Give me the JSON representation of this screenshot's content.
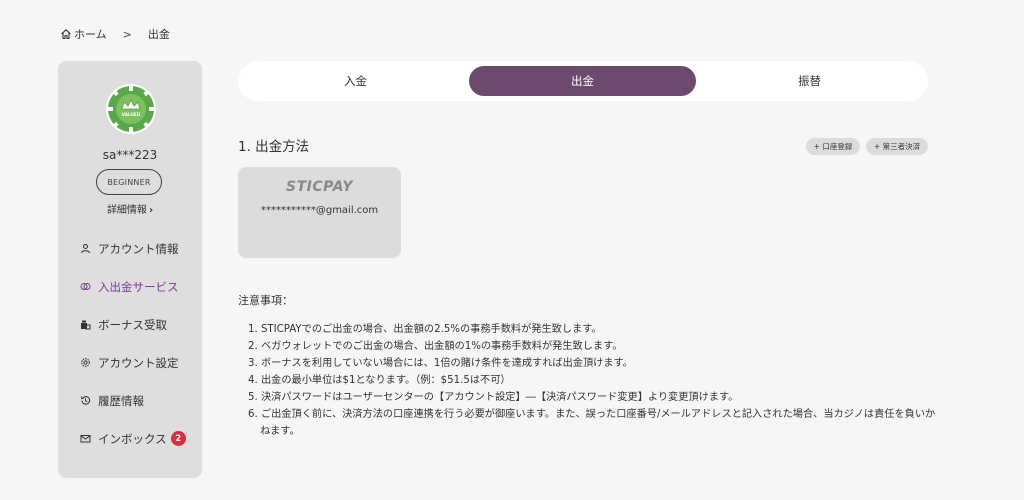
{
  "breadcrumb": {
    "home": "ホーム",
    "separator": ">",
    "current": "出金"
  },
  "profile": {
    "avatar_text": "VALUED",
    "username": "sa***223",
    "rank": "BEGINNER",
    "detail_link": "詳細情報"
  },
  "menu": [
    {
      "label": "アカウント情報",
      "icon": "user-icon"
    },
    {
      "label": "入出金サービス",
      "icon": "coins-icon",
      "active": true
    },
    {
      "label": "ボーナス受取",
      "icon": "gift-icon"
    },
    {
      "label": "アカウント設定",
      "icon": "gear-icon"
    },
    {
      "label": "履歴情報",
      "icon": "history-icon"
    },
    {
      "label": "インボックス",
      "icon": "mail-icon",
      "count": "2"
    }
  ],
  "tabs": [
    {
      "label": "入金"
    },
    {
      "label": "出金",
      "active": true
    },
    {
      "label": "振替"
    }
  ],
  "section": {
    "title": "1. 出金方法",
    "register_account": "+ 口座登録",
    "third_party": "+ 第三者決済"
  },
  "payment_method": {
    "name": "STICPAY",
    "email": "***********@gmail.com"
  },
  "notes": {
    "title": "注意事項：",
    "items": [
      "1. STICPAYでのご出金の場合、出金額の2.5%の事務手数料が発生致します。",
      "2. ベガウォレットでのご出金の場合、出金額の1%の事務手数料が発生致します。",
      "3. ボーナスを利用していない場合には、1倍の賭け条件を達成すれば出金頂けます。",
      "4. 出金の最小単位は$1となります。（例：$51.5は不可）",
      "5. 決済パスワードはユーザーセンターの【アカウント設定】―【決済パスワード変更】より変更頂けます。",
      "6. ご出金頂く前に、決済方法の口座連携を行う必要が御座います。また、誤った口座番号/メールアドレスと記入された場合、当カジノは責任を負いかねます。"
    ]
  },
  "colors": {
    "accent": "#6b4a6e",
    "active_text": "#7a3b91",
    "badge": "#e02b3b",
    "sidebar_bg": "#dedede"
  }
}
